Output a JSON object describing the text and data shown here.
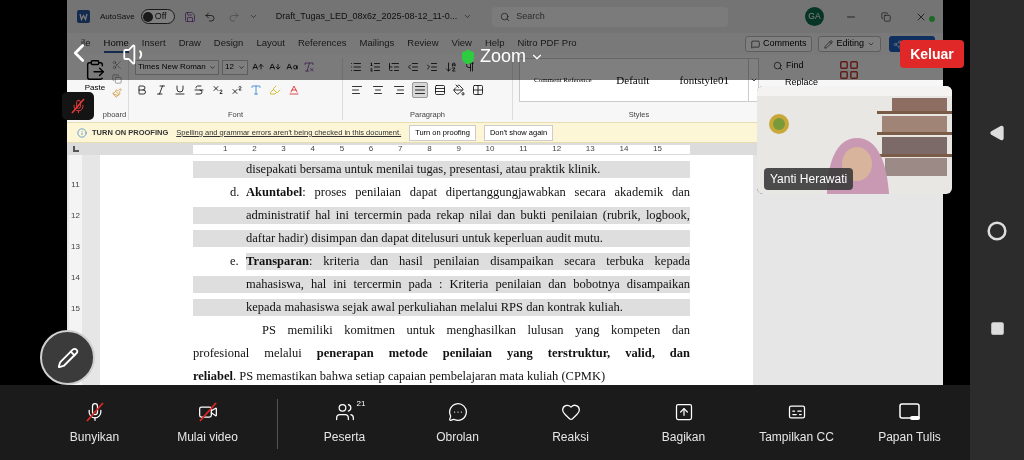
{
  "word": {
    "title_bar": {
      "autosave_label": "AutoSave",
      "autosave_on": false,
      "autosave_state": "Off",
      "filename": "Draft_Tugas_LED_08x6z_2025-08-12_11-0...",
      "search_placeholder": "Search",
      "avatar": "GA"
    },
    "tabs": [
      {
        "label": "ile",
        "selected": false
      },
      {
        "label": "Home",
        "selected": true
      },
      {
        "label": "Insert",
        "selected": false
      },
      {
        "label": "Draw",
        "selected": false
      },
      {
        "label": "Design",
        "selected": false
      },
      {
        "label": "Layout",
        "selected": false
      },
      {
        "label": "References",
        "selected": false
      },
      {
        "label": "Mailings",
        "selected": false
      },
      {
        "label": "Review",
        "selected": false
      },
      {
        "label": "View",
        "selected": false
      },
      {
        "label": "Help",
        "selected": false
      },
      {
        "label": "Nitro PDF Pro",
        "selected": false
      }
    ],
    "comments": "Comments",
    "editing": "Editing",
    "ribbon": {
      "paste": "Paste",
      "font_name": "Times New Roman",
      "font_size": "12",
      "align": [
        {
          "selected": false
        },
        {
          "selected": false
        },
        {
          "selected": false
        },
        {
          "selected": true
        }
      ],
      "styles": [
        "Comment Reference",
        "Default",
        "fontstyle01"
      ],
      "find": "Find",
      "replace": "Replace",
      "groups": [
        "pboard",
        "Font",
        "Paragraph",
        "Styles"
      ]
    },
    "proofing": {
      "title": "TURN ON PROOFING",
      "message": "Spelling and grammar errors aren't being checked in this document.",
      "buttons": [
        "Turn on proofing",
        "Don't show again"
      ]
    },
    "ruler": [
      "1",
      "2",
      "3",
      "4",
      "5",
      "6",
      "7",
      "8",
      "9",
      "10",
      "11",
      "12",
      "13",
      "14",
      "15"
    ],
    "vertical_ruler": [
      "11",
      "12",
      "13",
      "14",
      "15"
    ],
    "document": [
      {
        "kind": "continuation",
        "lines": [
          {
            "text": "disepakati bersama untuk menilai tugas, presentasi, atau praktik klinik.",
            "highlighted": true
          }
        ]
      },
      {
        "kind": "list_item",
        "marker": "d.",
        "lines": [
          {
            "text": "**Akuntabel**: proses penilaian dapat dipertanggungjawabkan secara akademik dan",
            "highlighted": false
          },
          {
            "text": "administratif hal ini tercermin pada rekap nilai dan bukti penilaian (rubrik, logbook,",
            "highlighted": true
          },
          {
            "text": "daftar hadir) disimpan dan dapat ditelusuri untuk keperluan audit mutu.",
            "highlighted": true
          }
        ]
      },
      {
        "kind": "list_item",
        "marker": "e.",
        "lines": [
          {
            "text": "**Transparan**: kriteria dan hasil penilaian disampaikan secara terbuka kepada",
            "highlighted": true
          },
          {
            "text": "mahasiswa, hal ini tercermin pada : Kriteria penilaian dan bobotnya disampaikan",
            "highlighted": true
          },
          {
            "text": "kepada mahasiswa sejak awal perkuliahan melalui RPS dan kontrak kuliah.",
            "highlighted": true
          }
        ]
      },
      {
        "kind": "paragraph",
        "lines": [
          {
            "text": "PS memiliki komitmen untuk menghasilkan lulusan yang kompeten dan",
            "highlighted": false
          },
          {
            "text": "profesional melalui **penerapan metode penilaian yang terstruktur, valid, dan**",
            "highlighted": false
          },
          {
            "text": "**reliabel**. PS memastikan bahwa setiap capaian pembelajaran mata kuliah (CPMK)",
            "highlighted": false
          }
        ]
      }
    ]
  },
  "meeting": {
    "title": "Zoom",
    "leave": "Keluar",
    "mic_muted": true
  },
  "video_tile": {
    "name": "Yanti Herawati",
    "kind": "picture"
  },
  "toolbar": [
    {
      "kind": "mic",
      "label": "Bunyikan",
      "off": true
    },
    {
      "kind": "video",
      "label": "Mulai video",
      "off": true
    },
    {
      "kind": "participants",
      "label": "Peserta",
      "count": "21"
    },
    {
      "kind": "chat",
      "label": "Obrolan"
    },
    {
      "kind": "reactions",
      "label": "Reaksi"
    },
    {
      "kind": "share",
      "label": "Bagikan"
    },
    {
      "kind": "captions",
      "label": "Tampilkan CC"
    },
    {
      "kind": "whiteboard",
      "label": "Papan Tulis"
    }
  ]
}
